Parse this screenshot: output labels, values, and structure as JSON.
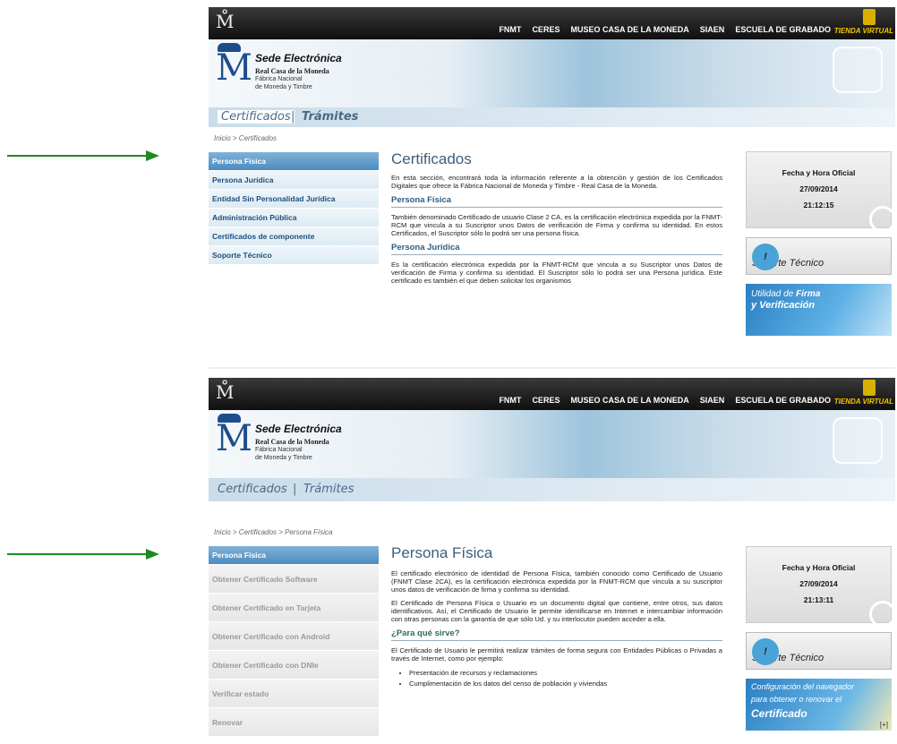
{
  "common": {
    "nav": [
      "FNMT",
      "CERES",
      "MUSEO CASA DE LA MONEDA",
      "SIAEN",
      "ESCUELA DE GRABADO"
    ],
    "tienda": "TIENDA VIRTUAL",
    "sede": "Sede Electrónica",
    "rcm": "Real Casa de la Moneda",
    "fnmt1": "Fábrica Nacional",
    "fnmt2": "de Moneda y Timbre",
    "tab_cert": "Certificados",
    "tab_sep": "|",
    "tab_tram": "Trámites",
    "soporte": "Soporte Técnico",
    "fecha_label": "Fecha y Hora Oficial",
    "date": "27/09/2014"
  },
  "top": {
    "breadcrumb": "Inicio >  Certificados",
    "side": [
      "Persona Física",
      "Persona Jurídica",
      "Entidad Sin Personalidad Jurídica",
      "Administración Pública",
      "Certificados de componente",
      "Soporte Técnico"
    ],
    "title": "Certificados",
    "intro": "En esta sección, encontrará toda la información referente a la obtención y gestión de los Certificados Digitales que ofrece la Fábrica Nacional de Moneda y Timbre - Real Casa de la Moneda.",
    "h_pf": "Persona Física",
    "p_pf": "También denominado Certificado de usuario Clase 2 CA, es la certificación electrónica expedida por la FNMT-RCM que vincula a su Suscriptor unos Datos de verificación de Firma y confirma su identidad. En estos Certificados, el Suscriptor sólo lo podrá ser una persona física.",
    "h_pj": "Persona Jurídica",
    "p_pj": "Es la certificación electrónica expedida por la FNMT-RCM que vincula a su Suscriptor unos Datos de verificación de Firma y confirma su identidad. El Suscriptor sólo lo podrá ser una Persona jurídica. Este certificado es también el que deben solicitar los organismos",
    "time": "21:12:15",
    "promo_a": "Utilidad de",
    "promo_a2": "Firma",
    "promo_b": "y Verificación"
  },
  "bottom": {
    "breadcrumb": "Inicio >  Certificados >  Persona Física",
    "side": [
      "Persona Física",
      "Obtener Certificado Software",
      "Obtener Certificado en Tarjeta",
      "Obtener Certificado con Android",
      "Obtener Certificado con DNIe",
      "Verificar estado",
      "Renovar"
    ],
    "title": "Persona Física",
    "p1": "El certificado electrónico de identidad de Persona Física, también conocido como Certificado de Usuario (FNMT Clase 2CA), es la certificación electrónica expedida por la FNMT-RCM que vincula a su suscriptor unos datos de verificación de firma y confirma su identidad.",
    "p2": "El Certificado de Persona Física o Usuario es un documento digital que contiene, entre otros, sus datos identificativos. Así, el Certificado de Usuario le permite identificarse en Internet e intercambiar información con otras personas con la garantía de que sólo Ud. y su interlocutor pueden acceder a ella.",
    "h_para": "¿Para qué sirve?",
    "p3": "El Certificado de Usuario le permitirá realizar trámites de forma segura con Entidades Públicas o Privadas a través de Internet, como por ejemplo:",
    "bullets": [
      "Presentación de recursos y reclamaciones",
      "Cumplimentación de los datos del censo de población y viviendas"
    ],
    "time": "21:13:11",
    "promo_a": "Configuración del navegador",
    "promo_a2": "para obtener o renovar el",
    "promo_b": "Certificado",
    "plus": "[+]"
  },
  "colors": {
    "arrow": "#1f8a1f",
    "accent": "#4c8cc0"
  }
}
